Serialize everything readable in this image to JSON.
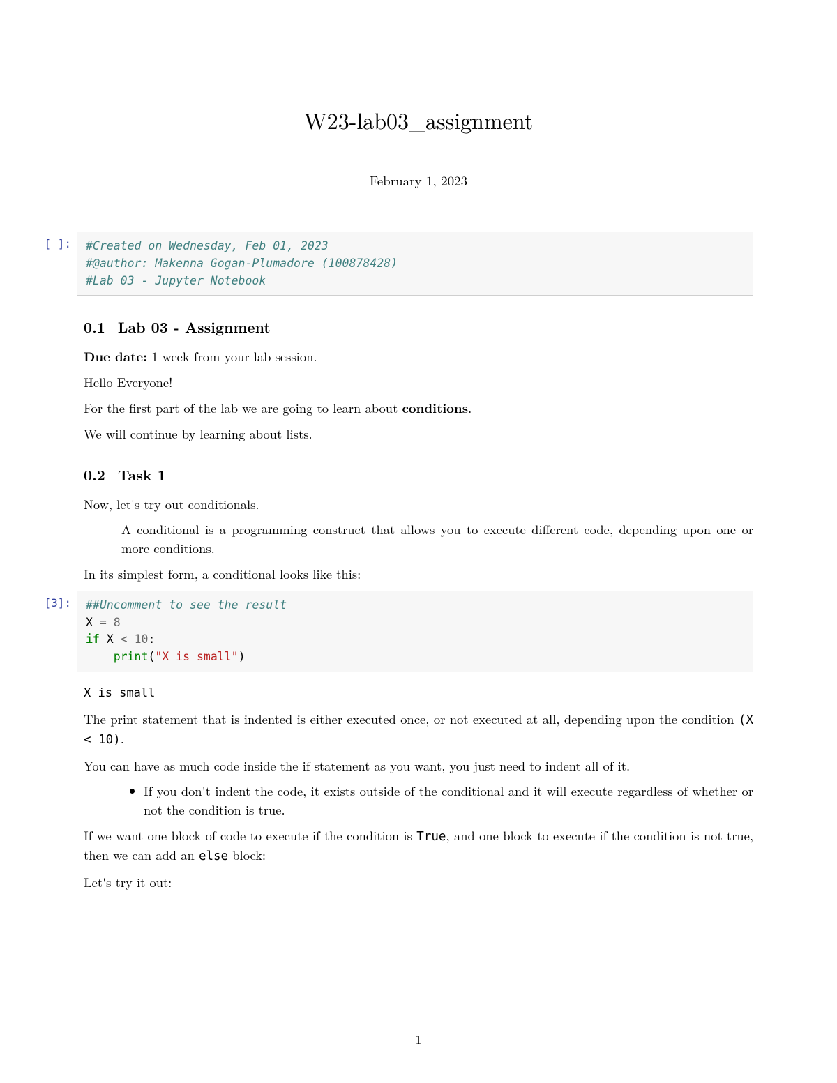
{
  "title": "W23-lab03_assignment",
  "date": "February 1, 2023",
  "cell1": {
    "prompt": "[ ]:",
    "line1": "#Created on Wednesday, Feb 01, 2023",
    "line2": "#@author: Makenna Gogan-Plumadore (100878428)",
    "line3": "#Lab 03 - Jupyter Notebook"
  },
  "sec01_num": "0.1",
  "sec01_title": "Lab 03 - Assignment",
  "due_label": "Due date:",
  "due_text": " 1 week from your lab session.",
  "hello": "Hello Everyone!",
  "intro_part1": "For the first part of the lab we are going to learn about ",
  "intro_bold": "conditions",
  "intro_part2": ".",
  "cont": "We will continue by learning about lists.",
  "sec02_num": "0.2",
  "sec02_title": "Task 1",
  "task1_intro": "Now, let's try out conditionals.",
  "task1_quote": "A conditional is a programming construct that allows you to execute different code, depending upon one or more conditions.",
  "task1_simplest": "In its simplest form, a conditional looks like this:",
  "cell2": {
    "prompt": "[3]:",
    "l1": "##Uncomment to see the result",
    "l2a": "X ",
    "l2op": "=",
    "l2b": " ",
    "l2num": "8",
    "l3if": "if",
    "l3a": " X ",
    "l3lt": "<",
    "l3b": " ",
    "l3num": "10",
    "l3c": ":",
    "l4indent": "    ",
    "l4fn": "print",
    "l4o": "(",
    "l4str": "\"X is small\"",
    "l4c": ")"
  },
  "output1": "X is small",
  "para_exec_a": "The print statement that is indented is either executed once, or not executed at all, depending upon the condition ",
  "para_exec_code": "(X < 10)",
  "para_exec_b": ".",
  "para_much": "You can have as much code inside the if statement as you want, you just need to indent all of it.",
  "bullet1": "If you don't indent the code, it exists outside of the conditional and it will execute regardless of whether or not the condition is true.",
  "para_else_a": "If we want one block of code to execute if the condition is ",
  "para_else_true": "True",
  "para_else_b": ", and one block to execute if the condition is not true, then we can add an ",
  "para_else_else": "else",
  "para_else_c": " block:",
  "try_out": "Let's try it out:",
  "page_number": "1"
}
